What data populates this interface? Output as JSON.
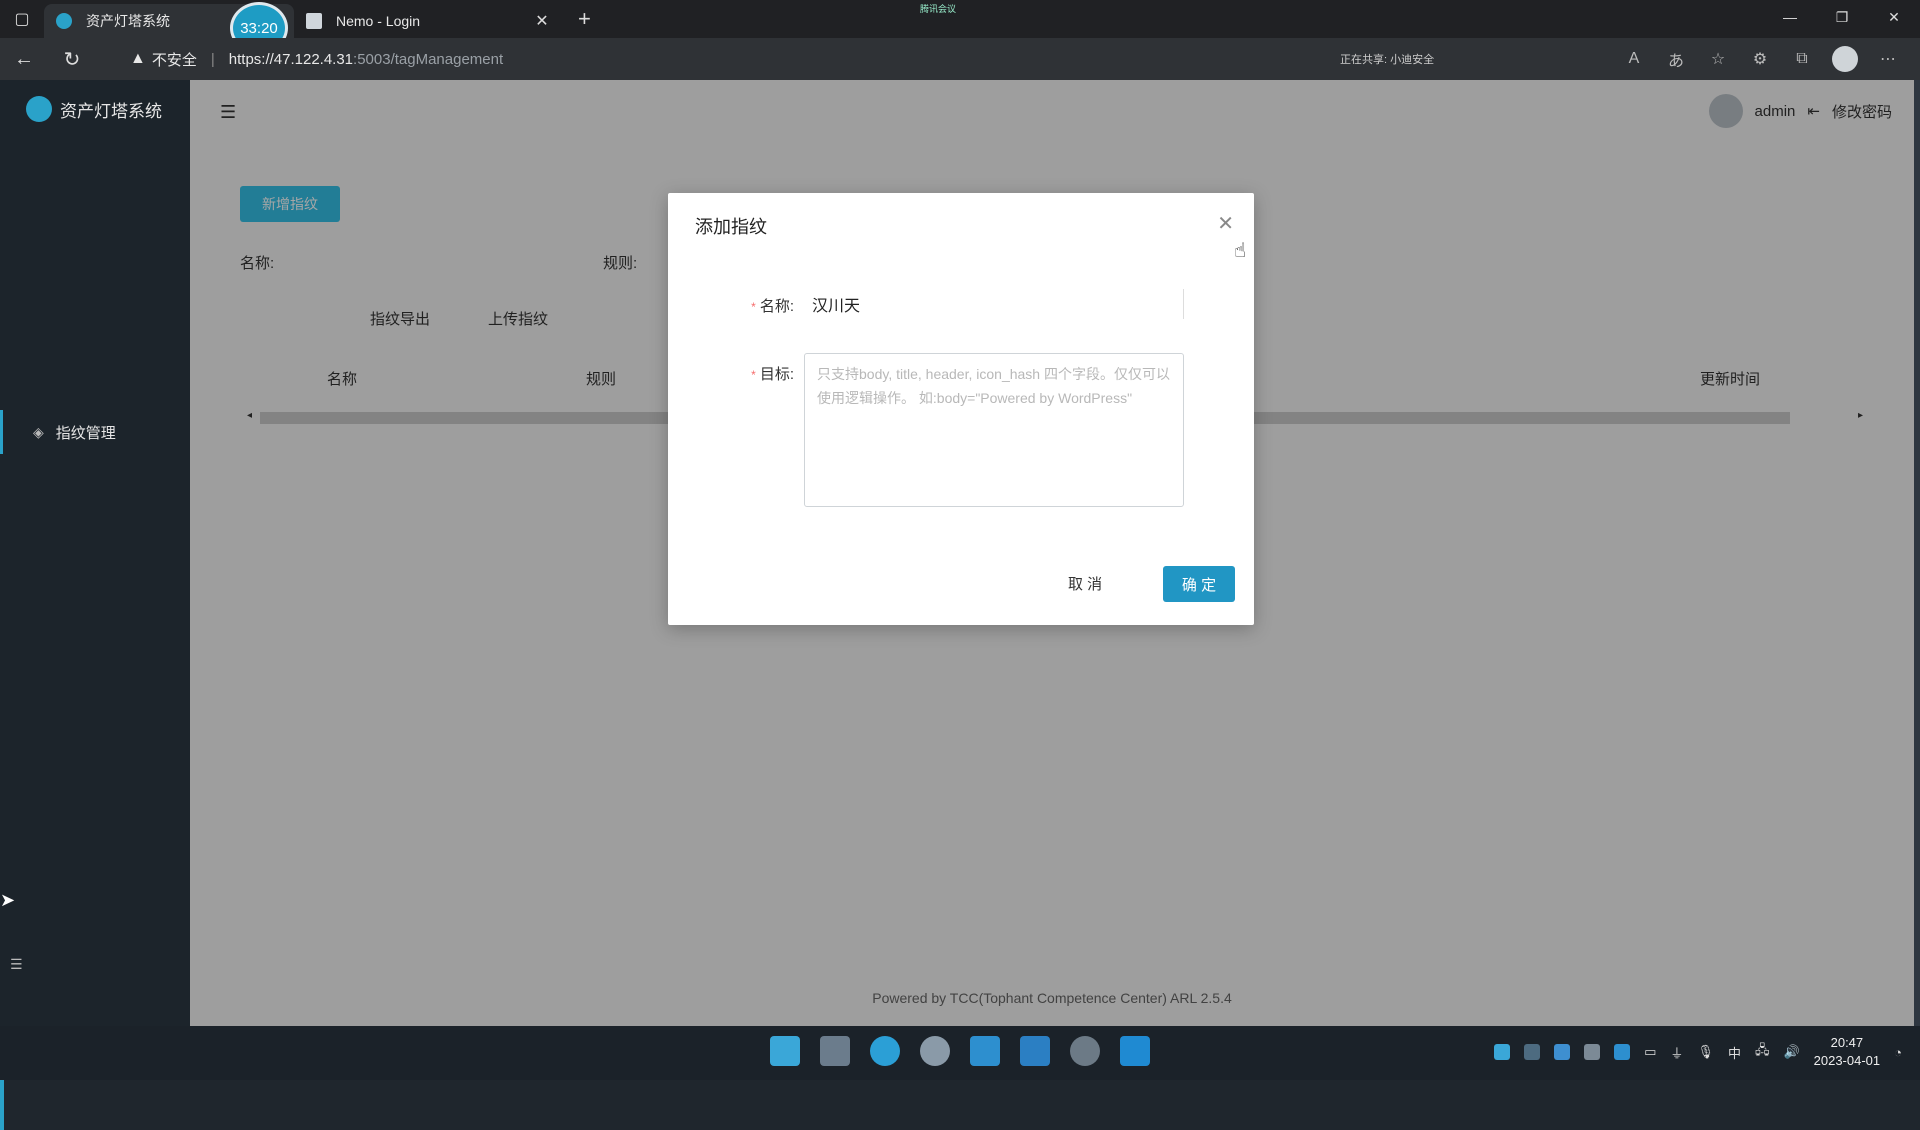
{
  "browser": {
    "tabs": [
      {
        "title": "资产灯塔系统"
      },
      {
        "title": "Nemo - Login"
      }
    ],
    "timer": "33:20",
    "security_text": "不安全",
    "url_host": "https://47.122.4.31",
    "url_path": ":5003/tagManagement",
    "status_text": "正在共享: 小迪安全",
    "screen_share_title": "腾讯会议"
  },
  "app": {
    "name": "资产灯塔系统",
    "sidebar_item": "指纹管理",
    "user": "admin",
    "change_password": "修改密码",
    "add_button": "新增指纹",
    "filter_name_label": "名称:",
    "filter_rule_label": "规则:",
    "export_button": "指纹导出",
    "upload_button": "上传指纹",
    "columns": [
      "名称",
      "规则",
      "更新时间"
    ],
    "footer": "Powered by TCC(Tophant Competence Center) ARL 2.5.4"
  },
  "modal": {
    "title": "添加指纹",
    "name_label": "名称:",
    "name_value": "汉川天",
    "target_label": "目标:",
    "target_placeholder": "只支持body, title, header, icon_hash 四个字段。仅仅可以使用逻辑操作。 如:body=\"Powered by WordPress\"",
    "cancel_label": "取 消",
    "confirm_label": "确 定"
  },
  "taskbar": {
    "time": "20:47",
    "date": "2023-04-01",
    "ime": "中"
  },
  "colors": {
    "accent": "#2196c4",
    "primary_light": "#35c0e6",
    "sidebar_bg": "#1c242b"
  }
}
